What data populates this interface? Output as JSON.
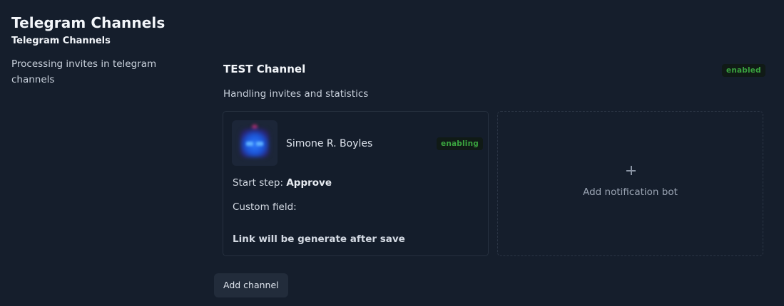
{
  "header": {
    "title": "Telegram Channels",
    "subtitle": "Telegram Channels",
    "description": "Processing invites in telegram channels"
  },
  "channel": {
    "name": "TEST Channel",
    "status": "enabled",
    "description": "Handling invites and statistics"
  },
  "bot_card": {
    "avatar_icon": "robot-avatar-icon",
    "name": "Simone R. Boyles",
    "status": "enabling",
    "start_step_label": "Start step:",
    "start_step_value": "Approve",
    "custom_field_label": "Custom field:",
    "link_note": "Link will be generate after save"
  },
  "add_bot": {
    "icon": "plus-icon",
    "label": "Add notification bot"
  },
  "actions": {
    "add_channel_label": "Add channel"
  },
  "colors": {
    "background": "#151e2c",
    "badge_text": "#3aa33f",
    "badge_bg": "#101a16",
    "button_bg": "#222c3b"
  }
}
